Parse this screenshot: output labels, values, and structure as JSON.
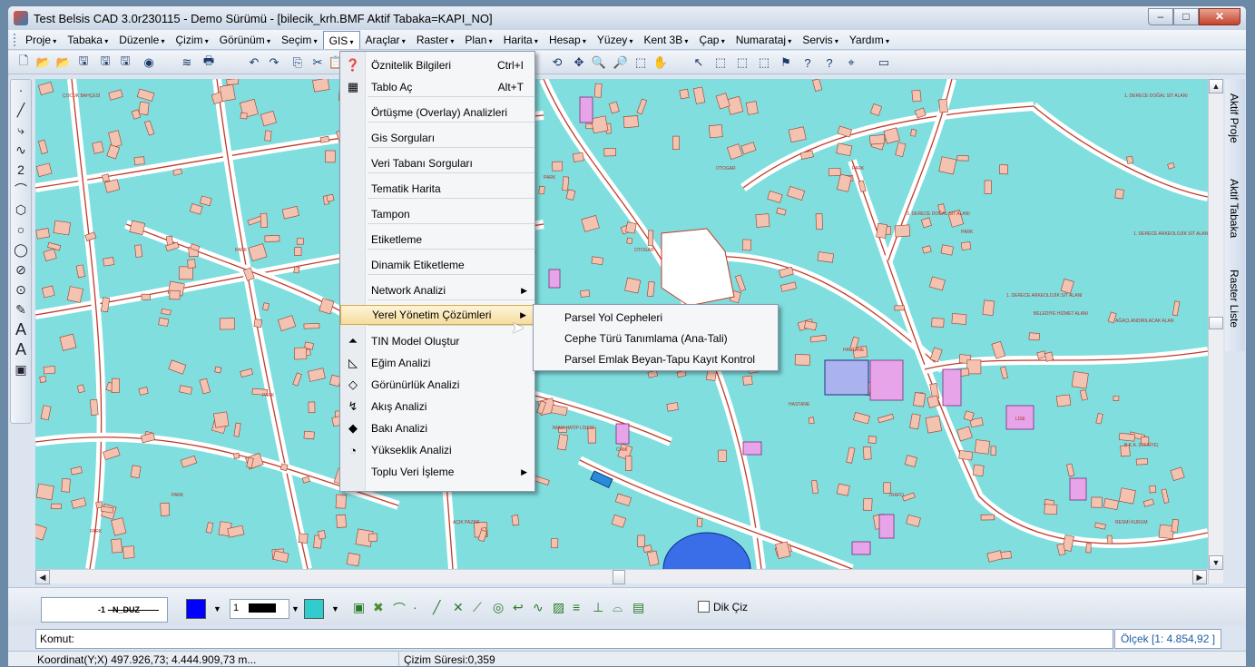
{
  "window": {
    "title": "Test Belsis CAD 3.0r230115 - Demo Sürümü - [bilecik_krh.BMF  Aktif Tabaka=KAPI_NO]"
  },
  "menubar": [
    "Proje",
    "Tabaka",
    "Düzenle",
    "Çizim",
    "Görünüm",
    "Seçim",
    "GIS",
    "Araçlar",
    "Raster",
    "Plan",
    "Harita",
    "Hesap",
    "Yüzey",
    "Kent 3B",
    "Çap",
    "Numarataj",
    "Servis",
    "Yardım"
  ],
  "gis_menu": [
    {
      "label": "Öznitelik Bilgileri",
      "shortcut": "Ctrl+I",
      "icon": "help-icon"
    },
    {
      "label": "Tablo Aç",
      "shortcut": "Alt+T",
      "icon": "table-icon"
    },
    {
      "label": "Örtüşme (Overlay) Analizleri"
    },
    {
      "label": "Gis Sorguları"
    },
    {
      "label": "Veri Tabanı Sorguları"
    },
    {
      "label": "Tematik Harita"
    },
    {
      "label": "Tampon"
    },
    {
      "label": "Etiketleme"
    },
    {
      "label": "Dinamik Etiketleme"
    },
    {
      "label": "Network Analizi",
      "submenu": true
    },
    {
      "label": "Yerel Yönetim Çözümleri",
      "submenu": true,
      "highlighted": true
    },
    {
      "label": "TIN Model Oluştur",
      "icon": "tin-icon"
    },
    {
      "label": "Eğim Analizi",
      "icon": "slope-icon"
    },
    {
      "label": "Görünürlük Analizi",
      "icon": "visibility-icon"
    },
    {
      "label": "Akış Analizi",
      "icon": "flow-icon"
    },
    {
      "label": "Bakı Analizi",
      "icon": "aspect-icon"
    },
    {
      "label": "Yükseklik Analizi",
      "icon": "elevation-icon"
    },
    {
      "label": "Toplu Veri İşleme",
      "submenu": true
    }
  ],
  "submenu": [
    "Parsel Yol Cepheleri",
    "Cephe Türü Tanımlama (Ana-Tali)",
    "Parsel Emlak Beyan-Tapu Kayıt Kontrol"
  ],
  "right_panel": {
    "aktif_proje": "Aktif Proje",
    "aktif_tabaka": "Aktif Tabaka",
    "raster_liste": "Raster Liste"
  },
  "bottom": {
    "line_style": "-1 - N_DUZ",
    "line_width": "1",
    "dik_ciz": "Dik Çiz",
    "color_primary": "#0000ff",
    "color_fill": "#33cccc"
  },
  "command": {
    "label": "Komut:"
  },
  "scale": {
    "label": "Ölçek [1: 4.854,92 ]"
  },
  "status": {
    "coords": "Koordinat(Y;X)  497.926,73; 4.444.909,73 m...",
    "time": "Çizim Süresi:0,359"
  },
  "map": {
    "background": "#80dede",
    "labels": [
      "PARK",
      "OTOGAR",
      "HASTANE",
      "ÇOCUK BAHÇESİ",
      "1. DERECE DOĞAL SİT ALANI",
      "3. DERECE DOĞAL SİT ALANI",
      "BELEDİYE HİZMET ALANI",
      "1. DERECE ARKEOLOJİK SİT ALANI",
      "AĞAÇLANDIRILACAK ALAN",
      "RESMİ KURUM",
      "CAMİ",
      "TRAFO",
      "AÇIK PAZAR",
      "İMAM HATİP LİSESİ",
      "LİSE",
      "B.K.A. (İTFAİYE)"
    ]
  }
}
